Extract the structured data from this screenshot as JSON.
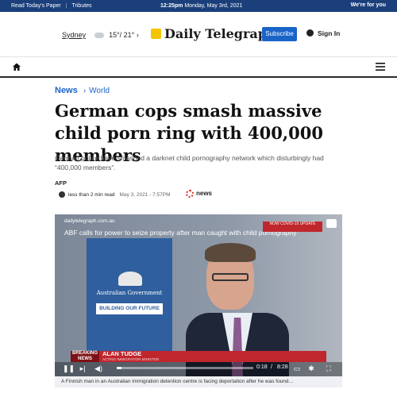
{
  "topbar": {
    "links": [
      "Read Today's Paper",
      "Tributes"
    ],
    "datetime_time": "12:25pm",
    "datetime_date": "Monday, May 3rd, 2021",
    "brand_tagline": "We're for you"
  },
  "weather": {
    "city": "Sydney",
    "temps": "15°/ 21°"
  },
  "masthead": {
    "logo": "Daily Telegraph",
    "subscribe": "Subscribe",
    "signin": "Sign In"
  },
  "breadcrumb": {
    "section": "News",
    "subsection": "World"
  },
  "article": {
    "headline": "German cops smash massive child porn ring with 400,000 members",
    "standfirst": "German police have smashed a darknet child pornography network which disturbingly had “400,000 members”.",
    "byline": "AFP",
    "read_time": "less than 2 min read",
    "published": "May 3, 2021 - 7:57PM",
    "publisher": "news"
  },
  "video": {
    "site": "dailytelegraph.com.au",
    "title": "ABF calls for power to seize property after man caught with child pornography",
    "live_badge": "NOW COVID-19 UPDATE",
    "backdrop_gov": "Australian Government",
    "backdrop_slogan": "BUILDING OUR FUTURE",
    "lower_third_tag": "BREAKING NEWS",
    "speaker_name": "ALAN TUDGE",
    "speaker_role": "ACTING IMMIGRATION MINISTER",
    "current_time": "0:18",
    "duration": "8:28",
    "progress": 0.035
  },
  "caption": "A Finnish man in an Australian immigration detention centre is facing deportation after he was found..."
}
